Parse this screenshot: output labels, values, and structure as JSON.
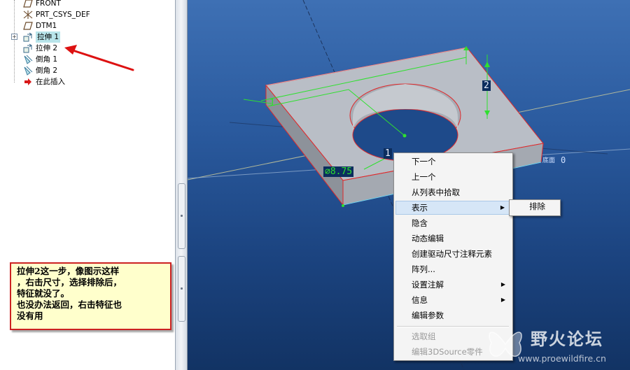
{
  "model_tree": {
    "items": [
      {
        "label": "FRONT",
        "icon": "datum-plane-icon"
      },
      {
        "label": "PRT_CSYS_DEF",
        "icon": "csys-icon"
      },
      {
        "label": "DTM1",
        "icon": "datum-plane-icon"
      },
      {
        "label": "拉伸 1",
        "icon": "extrude-icon",
        "selected": true,
        "expander": "+"
      },
      {
        "label": "拉伸 2",
        "icon": "extrude-icon"
      },
      {
        "label": "倒角 1",
        "icon": "chamfer-icon"
      },
      {
        "label": "倒角 2",
        "icon": "chamfer-icon"
      },
      {
        "label": "在此插入",
        "icon": "insert-arrow-icon"
      }
    ]
  },
  "note": {
    "lines": [
      "拉伸2这一步，像图示这样",
      "，右击尺寸，选择排除后，",
      "特征就没了。",
      "也没办法返回，右击特征也",
      "没有用"
    ],
    "border_color": "#cc2222",
    "background": "#ffffcc"
  },
  "viewport": {
    "dimension_diameter": "∅8.75",
    "dimension_vertical": "2",
    "dimension_left": "1",
    "dimension_hidden": "1",
    "datum_label": "底面",
    "datum_label_value": "0"
  },
  "context_menu": {
    "items": [
      {
        "label": "下一个"
      },
      {
        "label": "上一个"
      },
      {
        "label": "从列表中拾取"
      },
      {
        "label": "表示",
        "submenu": true,
        "highlighted": true
      },
      {
        "label": "隐含"
      },
      {
        "label": "动态编辑"
      },
      {
        "label": "创建驱动尺寸注释元素"
      },
      {
        "label": "阵列..."
      },
      {
        "label": "设置注解",
        "submenu": true
      },
      {
        "label": "信息",
        "submenu": true
      },
      {
        "label": "编辑参数"
      },
      {
        "label": "选取组",
        "disabled": true
      },
      {
        "label": "编辑3DSource零件",
        "disabled": true
      }
    ],
    "submenu_item": "排除"
  },
  "watermark": {
    "title": "野火论坛",
    "url": "www.proewildfire.cn"
  },
  "colors": {
    "viewport_top": "#3e70b4",
    "viewport_bottom": "#123364",
    "edge_red": "#e0282a",
    "dim_green": "#2fe02f",
    "annotation_arrow": "#dd1111"
  }
}
